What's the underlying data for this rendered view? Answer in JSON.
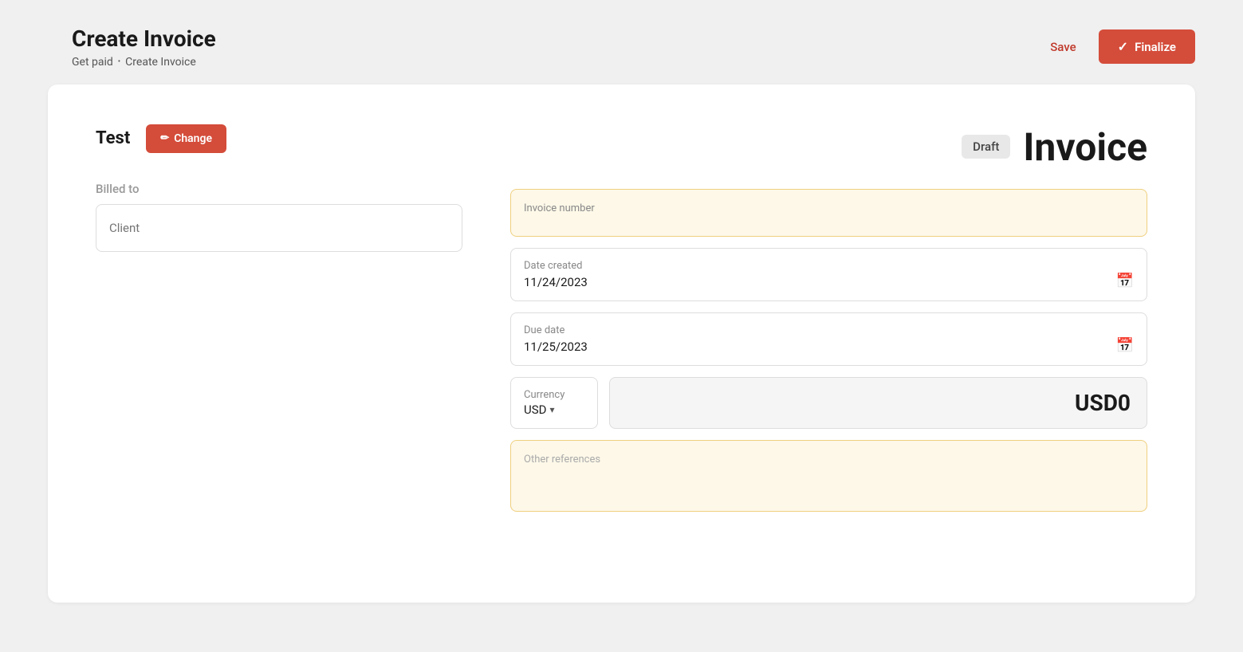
{
  "header": {
    "title": "Create Invoice",
    "breadcrumb": {
      "parent": "Get paid",
      "separator": "•",
      "current": "Create Invoice"
    },
    "actions": {
      "save_label": "Save",
      "finalize_label": "Finalize"
    }
  },
  "company": {
    "name": "Test",
    "change_label": "Change"
  },
  "billed_to": {
    "label": "Billed to",
    "placeholder": "Client"
  },
  "invoice": {
    "draft_badge": "Draft",
    "title": "Invoice",
    "number": {
      "label": "Invoice number",
      "value": ""
    },
    "date_created": {
      "label": "Date created",
      "value": "11/24/2023"
    },
    "due_date": {
      "label": "Due date",
      "value": "11/25/2023"
    },
    "currency": {
      "label": "Currency",
      "value": "USD"
    },
    "amount": {
      "value": "USD0"
    },
    "other_references": {
      "label": "Other references",
      "value": ""
    }
  }
}
